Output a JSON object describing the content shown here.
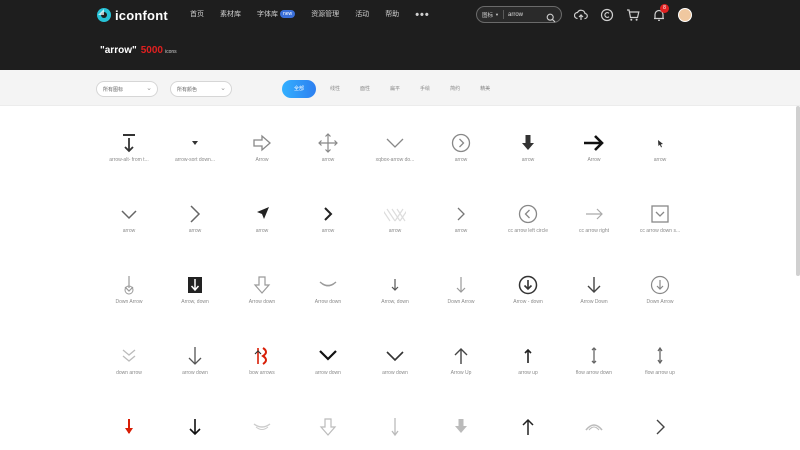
{
  "header": {
    "logo_text": "iconfont",
    "nav": [
      {
        "label": "首页"
      },
      {
        "label": "素材库"
      },
      {
        "label": "字体库",
        "badge": "new"
      },
      {
        "label": "资源管理"
      },
      {
        "label": "活动"
      },
      {
        "label": "帮助"
      }
    ],
    "more": "•••",
    "search": {
      "scope": "图标",
      "value": "arrow"
    },
    "notification_count": "8"
  },
  "result": {
    "query": "\"arrow\"",
    "count": "5000",
    "unit": "icons"
  },
  "filters": {
    "dropdowns": [
      {
        "label": "所有图标"
      },
      {
        "label": "所有颜色"
      }
    ],
    "tabs": [
      {
        "label": "全部",
        "active": true
      },
      {
        "label": "线性",
        "active": false
      },
      {
        "label": "面性",
        "active": false
      },
      {
        "label": "扁平",
        "active": false
      },
      {
        "label": "手绘",
        "active": false
      },
      {
        "label": "简约",
        "active": false
      },
      {
        "label": "精美",
        "active": false
      }
    ]
  },
  "icons": [
    {
      "label": "arrow-alt- from t...",
      "icon": "arrow-down-bar-icon"
    },
    {
      "label": "arrow-sort down...",
      "icon": "triangle-down-small-icon"
    },
    {
      "label": "Arrow",
      "icon": "arrow-right-outline-icon"
    },
    {
      "label": "arrow",
      "icon": "move-cross-icon"
    },
    {
      "label": "xqbox-arrow do...",
      "icon": "chevron-down-wide-icon"
    },
    {
      "label": "arrow",
      "icon": "circle-chevron-right-icon"
    },
    {
      "label": "arrow",
      "icon": "arrow-down-bold-icon"
    },
    {
      "label": "Arrow",
      "icon": "arrow-right-bold-icon"
    },
    {
      "label": "arrow",
      "icon": "cursor-pointer-icon"
    },
    {
      "label": "arrow",
      "icon": "chevron-down-icon"
    },
    {
      "label": "arrow",
      "icon": "chevron-right-icon"
    },
    {
      "label": "arrow",
      "icon": "navigation-arrow-icon"
    },
    {
      "label": "arrow",
      "icon": "chevron-right-bold-icon"
    },
    {
      "label": "arrow",
      "icon": "diagonal-pattern-icon"
    },
    {
      "label": "arrow",
      "icon": "chevron-right-thin-icon"
    },
    {
      "label": "cc arrow left circle",
      "icon": "circle-chevron-left-icon"
    },
    {
      "label": "cc arrow right",
      "icon": "arrow-right-thin-icon"
    },
    {
      "label": "cc arrow down s...",
      "icon": "square-chevron-down-icon"
    },
    {
      "label": "Down Arrow",
      "icon": "arrow-down-circle-tail-icon"
    },
    {
      "label": "Arrow, down",
      "icon": "arrow-down-box-icon"
    },
    {
      "label": "Arrow down",
      "icon": "arrow-down-outline-icon"
    },
    {
      "label": "Arrow down",
      "icon": "curve-down-icon"
    },
    {
      "label": "Arrow, down",
      "icon": "arrow-down-thin-icon"
    },
    {
      "label": "Down Arrow",
      "icon": "arrow-down-light-icon"
    },
    {
      "label": "Arrow - down",
      "icon": "circle-arrow-down-icon"
    },
    {
      "label": "Arrow Down",
      "icon": "arrow-down-icon"
    },
    {
      "label": "Down Arrow",
      "icon": "circle-chevron-down-icon"
    },
    {
      "label": "down arrow",
      "icon": "double-chevron-down-icon"
    },
    {
      "label": "arrow down",
      "icon": "arrow-down-line-icon"
    },
    {
      "label": "bow arrows",
      "icon": "bow-arrows-icon"
    },
    {
      "label": "arrow down",
      "icon": "chevron-down-bold-icon"
    },
    {
      "label": "arrow down",
      "icon": "chevron-down-medium-icon"
    },
    {
      "label": "Arrow Up",
      "icon": "arrow-up-icon"
    },
    {
      "label": "arrow up",
      "icon": "arrow-up-small-icon"
    },
    {
      "label": "flow arrow down",
      "icon": "flow-arrow-down-icon"
    },
    {
      "label": "flow arrow up",
      "icon": "flow-arrow-up-icon"
    },
    {
      "label": "",
      "icon": "arrow-down-red-icon"
    },
    {
      "label": "",
      "icon": "arrow-down-black-icon"
    },
    {
      "label": "",
      "icon": "curve-down-light-icon"
    },
    {
      "label": "",
      "icon": "arrow-down-hollow-icon"
    },
    {
      "label": "",
      "icon": "arrow-down-long-icon"
    },
    {
      "label": "",
      "icon": "arrow-down-gray-icon"
    },
    {
      "label": "",
      "icon": "arrow-up-line-icon"
    },
    {
      "label": "",
      "icon": "arc-up-icon"
    },
    {
      "label": "",
      "icon": "chevron-right-end-icon"
    }
  ],
  "colors": {
    "header_bg": "#1e1e1e",
    "accent": "#2d7ff0",
    "count": "#e02020",
    "icon_dark": "#333333",
    "icon_light": "#9a9a9a",
    "icon_red": "#d81e06"
  }
}
